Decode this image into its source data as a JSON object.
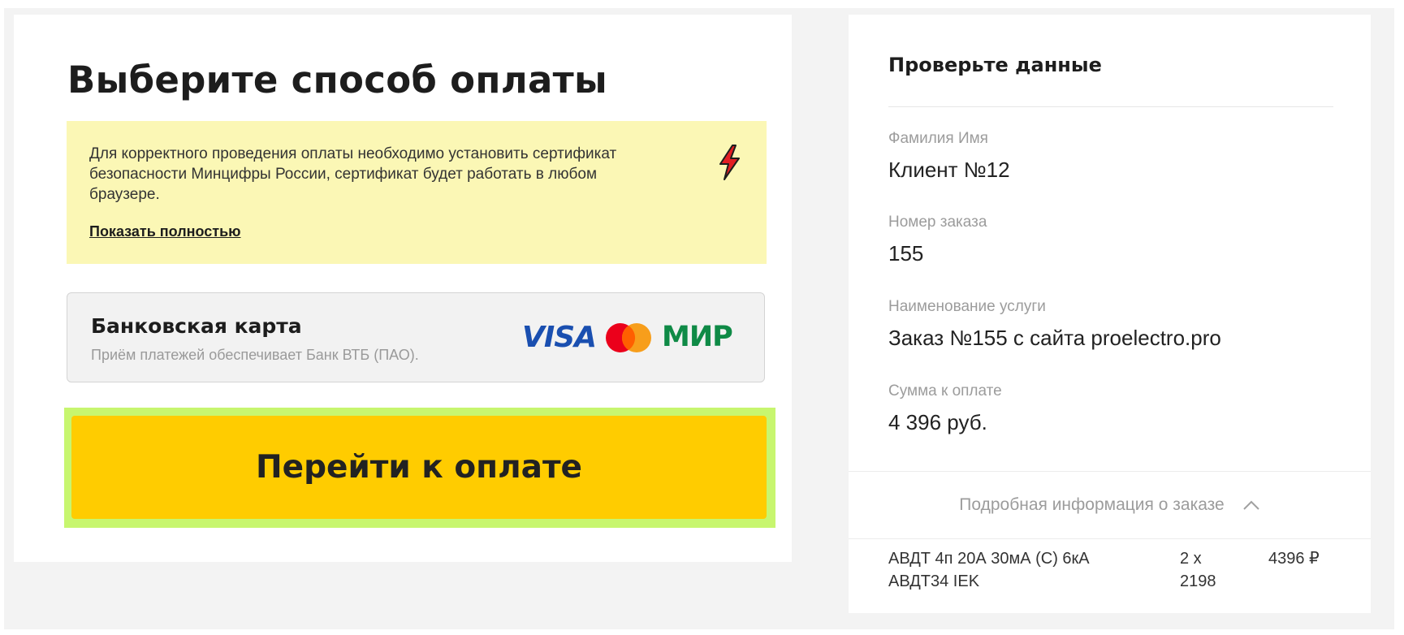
{
  "left": {
    "title": "Выберите способ оплаты",
    "notice": {
      "text": "Для корректного проведения оплаты необходимо установить сертификат безопасности Минцифры России, сертификат будет работать в любом браузере.",
      "link": "Показать полностью",
      "icon": "lightning-bolt-icon"
    },
    "payment_option": {
      "title": "Банковская карта",
      "subtitle": "Приём платежей обеспечивает Банк ВТБ (ПАО).",
      "logos": {
        "visa": "VISA",
        "mastercard": "mastercard-logo",
        "mir": "МИР"
      }
    },
    "pay_button": "Перейти к оплате"
  },
  "right": {
    "title": "Проверьте данные",
    "fields": [
      {
        "label": "Фамилия Имя",
        "value": "Клиент №12"
      },
      {
        "label": "Номер заказа",
        "value": "155"
      },
      {
        "label": "Наименование услуги",
        "value": "Заказ №155 с сайта proelectro.pro"
      },
      {
        "label": "Сумма к оплате",
        "value": "4 396 руб."
      }
    ],
    "details_toggle": "Подробная информация о заказе",
    "items": [
      {
        "name": "АВДТ 4п 20А 30мА (С) 6кА АВДТ34 IEK",
        "qty": "2 x 2198",
        "price": "4396 ₽"
      }
    ]
  },
  "colors": {
    "accent_yellow": "#ffcc00",
    "notice_bg": "#fbf7b5",
    "focus_outline": "#c7f66f",
    "bolt_red": "#e31e24",
    "visa_blue": "#1a4fb0",
    "mir_green": "#0f8a46"
  }
}
